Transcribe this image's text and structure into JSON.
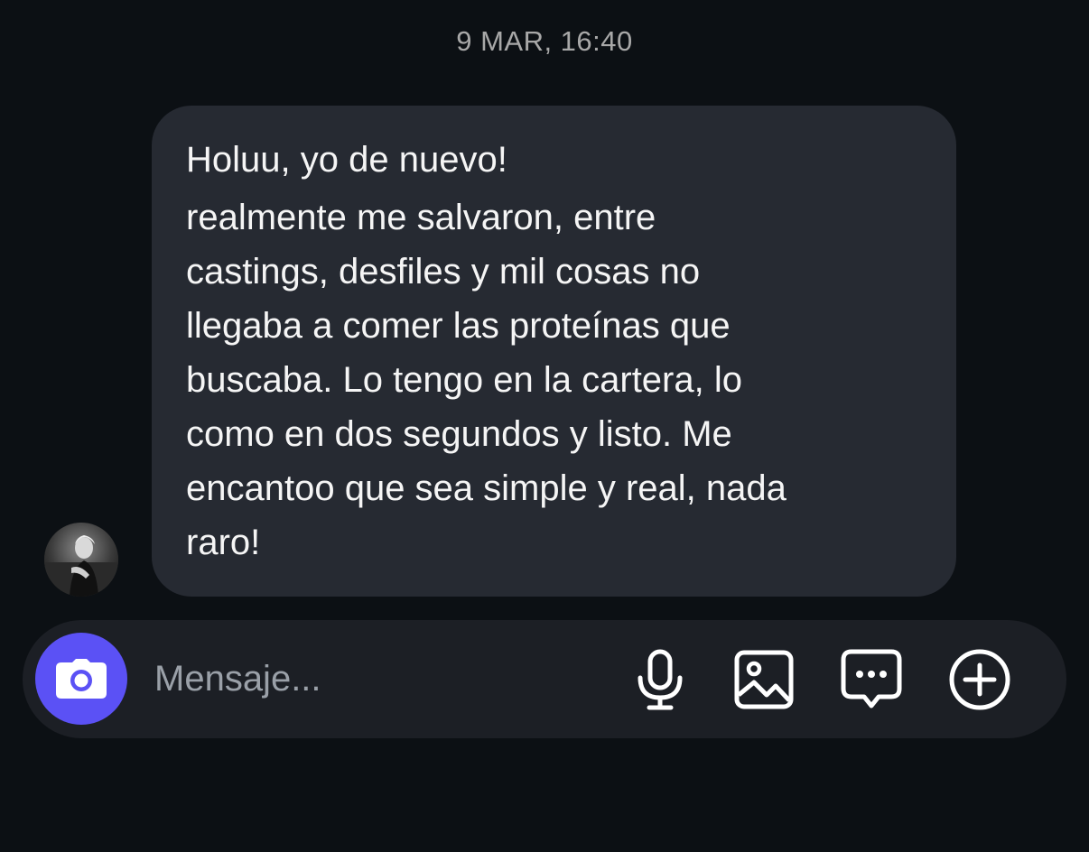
{
  "thread": {
    "timestamp": "9 MAR, 16:40"
  },
  "message": {
    "sender_avatar": "profile-photo",
    "first_line": "Holuu, yo de nuevo!",
    "body_lines": [
      "realmente me salvaron, entre",
      "castings, desfiles y mil cosas no",
      "llegaba a comer las proteínas que",
      "buscaba. Lo tengo en la cartera, lo",
      "como en dos segundos y listo. Me",
      "encantoo que sea simple y real, nada",
      "raro!"
    ]
  },
  "composer": {
    "placeholder": "Mensaje...",
    "value": "",
    "icons": {
      "camera": "camera-icon",
      "mic": "microphone-icon",
      "gallery": "image-icon",
      "sticker": "chat-bubble-dots-icon",
      "more": "plus-circle-icon"
    }
  },
  "colors": {
    "background": "#0c1014",
    "bubble": "#262a32",
    "composer": "#1c1f25",
    "camera_button": "#5b51f5",
    "timestamp_text": "#a8a8a8",
    "placeholder_text": "#9aa0a8"
  }
}
